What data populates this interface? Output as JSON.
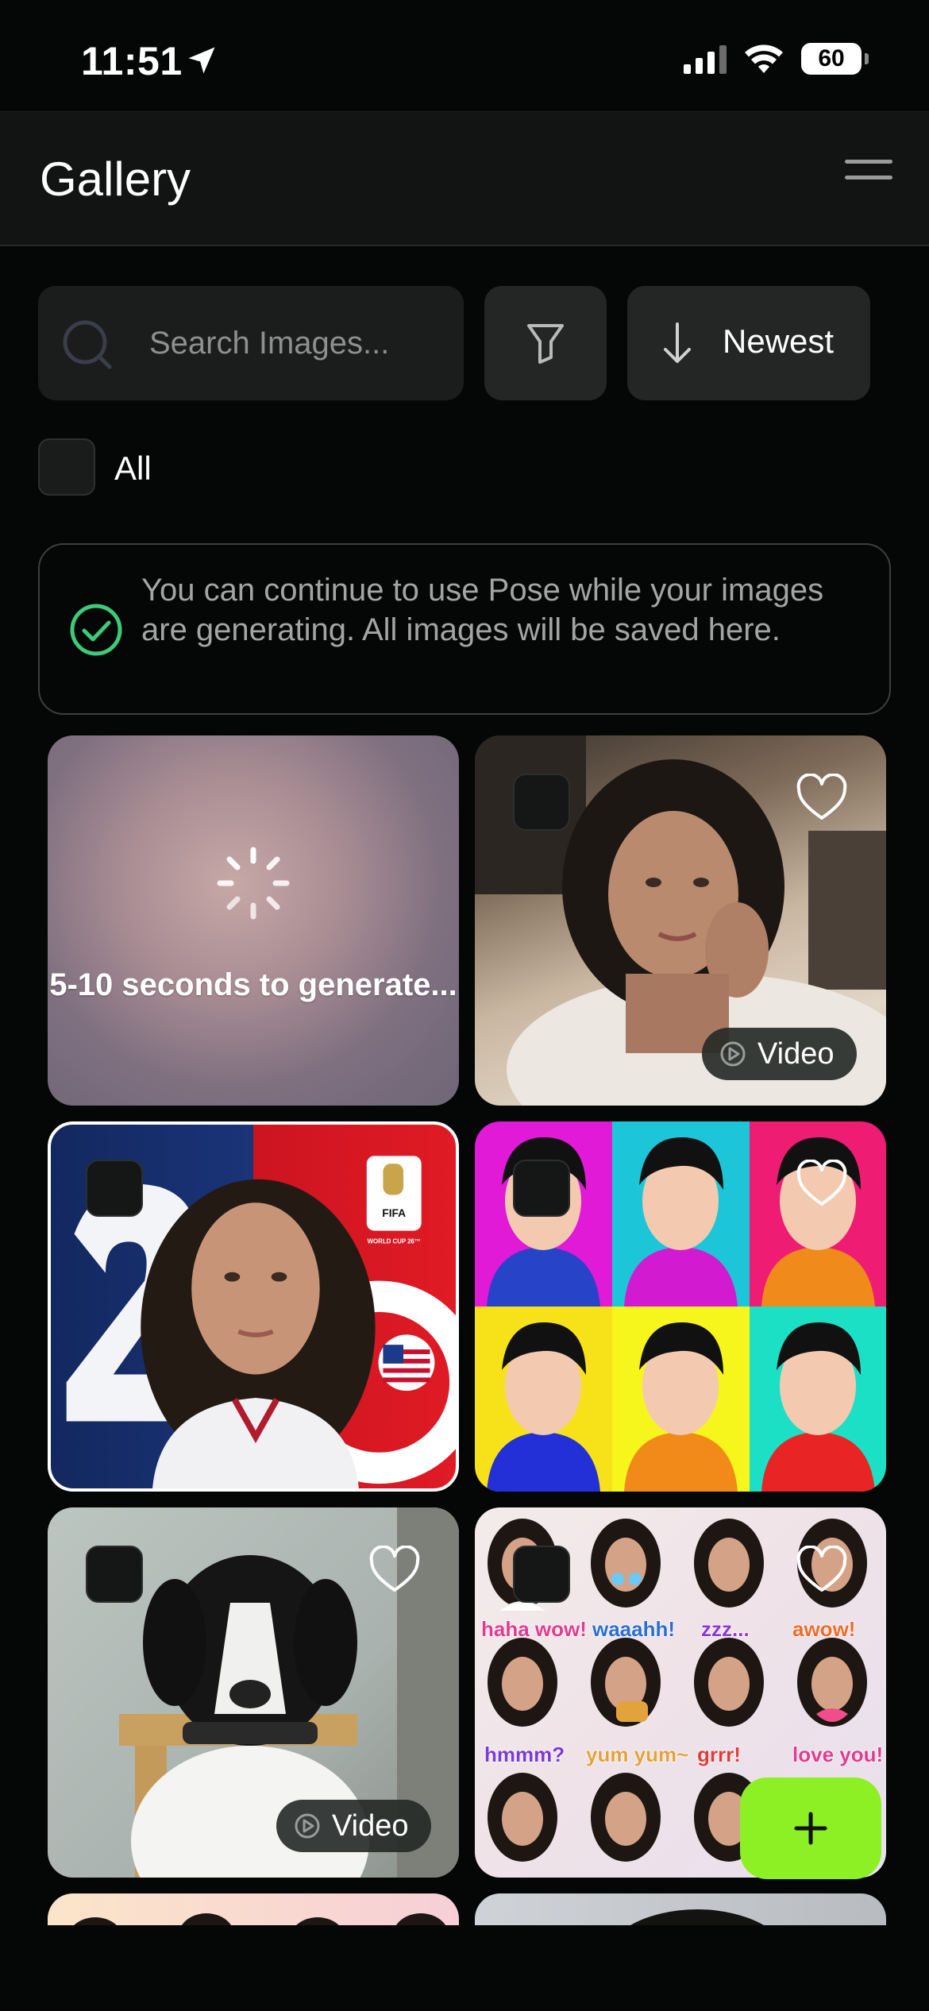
{
  "status_bar": {
    "time": "11:51",
    "battery": "60"
  },
  "header": {
    "title": "Gallery",
    "menu_icon": "hamburger-icon"
  },
  "toolbar": {
    "search_placeholder": "Search Images...",
    "filter_icon": "filter-icon",
    "sort_label": "Newest",
    "sort_icon": "arrow-down-icon"
  },
  "select_all_label": "All",
  "banner": {
    "text": "You can continue to use Pose while your images are generating. All images will be saved here.",
    "icon": "check-circle-icon",
    "accent": "#3ccb78"
  },
  "grid": {
    "generating_text": "5-10 seconds to generate...",
    "video_label": "Video",
    "items": [
      {
        "kind": "generating"
      },
      {
        "kind": "video",
        "subject": "woman lying in bed selfie"
      },
      {
        "kind": "image",
        "subject": "woman with FIFA World Cup 26 backdrop",
        "logo_text": [
          "FIFA",
          "WORLD CUP 26™"
        ]
      },
      {
        "kind": "image",
        "subject": "pop-art grid of man portraits"
      },
      {
        "kind": "video",
        "subject": "black and white dog on chair"
      },
      {
        "kind": "image",
        "subject": "sticker sheet of woman expressions",
        "sticker_texts": [
          "haha wow!",
          "waaahh!",
          "zzz...",
          "awow!",
          "hmmm?",
          "yum yum~",
          "grrr!",
          "love you!"
        ]
      },
      {
        "kind": "image",
        "subject": "partially visible"
      },
      {
        "kind": "image",
        "subject": "partially visible"
      }
    ]
  },
  "fab": {
    "icon": "plus-icon",
    "color": "#8cf024"
  }
}
